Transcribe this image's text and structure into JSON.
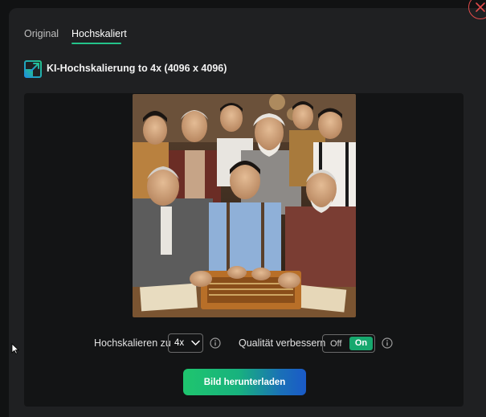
{
  "tabs": [
    {
      "label": "Original",
      "active": false
    },
    {
      "label": "Hochskaliert",
      "active": true
    }
  ],
  "header": {
    "title": "KI-Hochskalierung to 4x (4096 x 4096)",
    "icon": "upscale-arrow-icon"
  },
  "controls": {
    "scale_label": "Hochskalieren zu",
    "scale_value": "4x",
    "quality_label": "Qualität verbessern",
    "toggle_off": "Off",
    "toggle_on": "On",
    "toggle_state": "on"
  },
  "download_button": "Bild herunterladen",
  "colors": {
    "accent": "#24c38a",
    "close": "#e04a4a",
    "toggle_on": "#17a86e"
  }
}
